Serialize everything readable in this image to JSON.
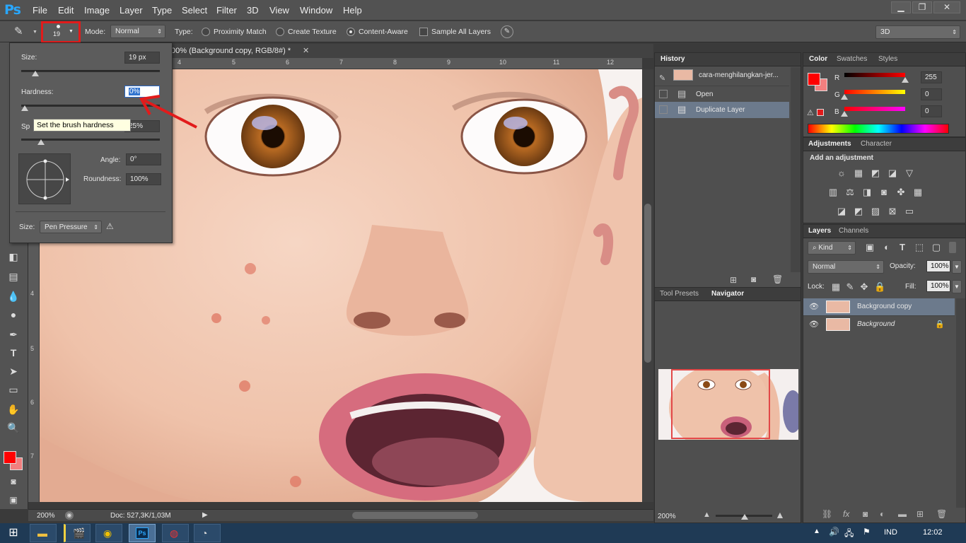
{
  "app": {
    "logo": "Ps"
  },
  "menu": [
    "File",
    "Edit",
    "Image",
    "Layer",
    "Type",
    "Select",
    "Filter",
    "3D",
    "View",
    "Window",
    "Help"
  ],
  "options": {
    "brush_size": "19",
    "mode_label": "Mode:",
    "mode_value": "Normal",
    "type_label": "Type:",
    "type_options": [
      "Proximity Match",
      "Create Texture",
      "Content-Aware"
    ],
    "type_selected": "Content-Aware",
    "sample_all_layers": "Sample All Layers",
    "workspace": "3D"
  },
  "brush_panel": {
    "size_label": "Size:",
    "size_value": "19 px",
    "size_level": 0.08,
    "hardness_label": "Hardness:",
    "hardness_value": "0%",
    "hardness_level": 0.0,
    "spacing_label": "Sp",
    "spacing_value": "25%",
    "spacing_level": 0.12,
    "angle_label": "Angle:",
    "angle_value": "0°",
    "roundness_label": "Roundness:",
    "roundness_value": "100%",
    "pen_size_label": "Size:",
    "pen_size_value": "Pen Pressure",
    "tooltip": "Set the brush hardness"
  },
  "document": {
    "tab_title": "00% (Background copy, RGB/8#) *",
    "ruler_top": [
      "4",
      "5",
      "6",
      "7",
      "8",
      "9",
      "10",
      "11",
      "12"
    ],
    "ruler_left": [
      "4",
      "5",
      "6",
      "7"
    ],
    "zoom": "200%",
    "doc_info": "Doc: 527,3K/1,03M"
  },
  "history": {
    "tab": "History",
    "snapshot": "cara-menghilangkan-jer...",
    "items": [
      "Open",
      "Duplicate Layer"
    ],
    "selected": "Duplicate Layer"
  },
  "navigator": {
    "tabs": [
      "Tool Presets",
      "Navigator"
    ],
    "active": "Navigator",
    "zoom": "200%"
  },
  "color": {
    "tabs": [
      "Color",
      "Swatches",
      "Styles"
    ],
    "active": "Color",
    "channels": [
      {
        "name": "R",
        "value": "255"
      },
      {
        "name": "G",
        "value": "0"
      },
      {
        "name": "B",
        "value": "0"
      }
    ],
    "foreground": "#ff0000",
    "background": "#f27f7f"
  },
  "adjustments": {
    "tabs": [
      "Adjustments",
      "Character"
    ],
    "active": "Adjustments",
    "heading": "Add an adjustment"
  },
  "layers": {
    "tabs": [
      "Layers",
      "Channels"
    ],
    "active": "Layers",
    "filter_kind": "Kind",
    "blend_mode": "Normal",
    "opacity_label": "Opacity:",
    "opacity_value": "100%",
    "lock_label": "Lock:",
    "fill_label": "Fill:",
    "fill_value": "100%",
    "items": [
      {
        "name": "Background copy",
        "selected": true
      },
      {
        "name": "Background",
        "selected": false
      }
    ]
  },
  "taskbar": {
    "lang": "IND",
    "time": "12:02"
  }
}
